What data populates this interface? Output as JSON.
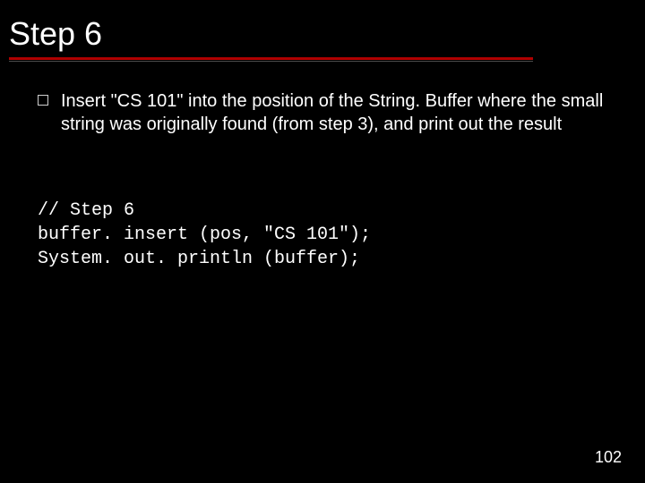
{
  "title": "Step 6",
  "bullets": [
    {
      "text": "Insert \"CS 101\" into the position of the String. Buffer where the small string was originally found (from step 3), and print out the result"
    }
  ],
  "code": {
    "line1": "// Step 6",
    "line2": "buffer. insert (pos, \"CS 101\");",
    "line3": "System. out. println (buffer);"
  },
  "page_number": "102"
}
